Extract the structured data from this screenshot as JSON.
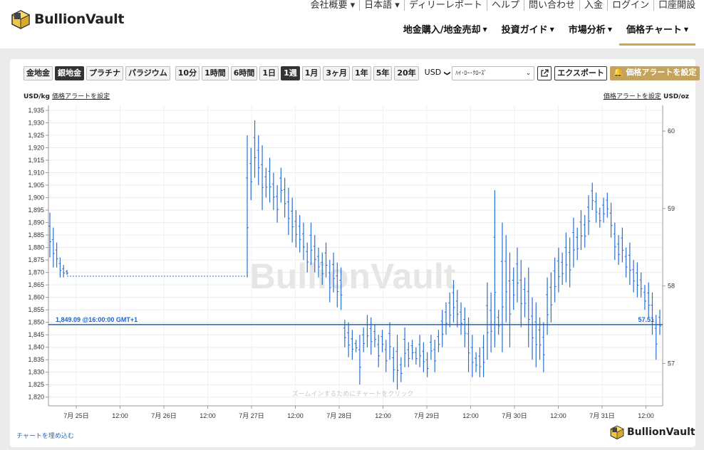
{
  "brand": {
    "name": "BullionVault"
  },
  "top_links": [
    "会社概要 ▾",
    "日本語 ▾",
    "ディリーレポート",
    "ヘルプ",
    "問い合わせ",
    "入金",
    "ログイン",
    "口座開設"
  ],
  "main_nav": [
    {
      "label": "地金購入/地金売却"
    },
    {
      "label": "投資ガイド"
    },
    {
      "label": "市場分析"
    },
    {
      "label": "価格チャート",
      "active": true
    }
  ],
  "toolbar": {
    "metals": [
      "金地金",
      "銀地金",
      "プラチナ",
      "パラジウム"
    ],
    "active_metal": "銀地金",
    "ranges": [
      "10分",
      "1時間",
      "6時間",
      "1日",
      "1週",
      "1月",
      "3ヶ月",
      "1年",
      "5年",
      "20年"
    ],
    "active_range": "1週",
    "currency": "USD",
    "currency_caret": "❯",
    "chart_type": "ﾊｲ･ﾛｰ･ｸﾛｰｽﾞ",
    "export_label": "エクスポート",
    "alert_label": "価格アラートを設定"
  },
  "left_unit": {
    "unit": "USD/kg",
    "link": "価格アラートを設定"
  },
  "right_unit": {
    "unit": "USD/oz",
    "link": "価格アラートを設定"
  },
  "embed_link": "チャートを埋め込む",
  "watermark": "BullionVault",
  "zoom_hint": "ズームインするためにチャートをクリック",
  "chart_data": {
    "type": "ohlc",
    "y_left": {
      "label": "USD/kg",
      "range": [
        1816.5,
        1937
      ],
      "ticks": [
        1820,
        1825,
        1830,
        1835,
        1840,
        1845,
        1850,
        1855,
        1860,
        1865,
        1870,
        1875,
        1880,
        1885,
        1890,
        1895,
        1900,
        1905,
        1910,
        1915,
        1920,
        1925,
        1930,
        1935
      ],
      "tick_labels": [
        "1,820",
        "1,825",
        "1,830",
        "1,835",
        "1,840",
        "1,845",
        "1,850",
        "1,855",
        "1,860",
        "1,865",
        "1,870",
        "1,875",
        "1,880",
        "1,885",
        "1,890",
        "1,895",
        "1,900",
        "1,905",
        "1,910",
        "1,915",
        "1,920",
        "1,925",
        "1,930",
        "1,935"
      ]
    },
    "y_right": {
      "label": "USD/oz",
      "ticks": [
        57,
        58,
        59,
        60
      ],
      "tick_labels": [
        "57",
        "58",
        "59",
        "60"
      ]
    },
    "x_ticks": [
      "7月 25日",
      "12:00",
      "7月 26日",
      "12:00",
      "7月 27日",
      "12:00",
      "7月 28日",
      "12:00",
      "7月 29日",
      "12:00",
      "7月 30日",
      "12:00",
      "7月 31日",
      "12:00"
    ],
    "current_price_label": "1,849.09 @16:00:00 GMT+1",
    "current_price_value": 1849.09,
    "current_oz_label": "57.51",
    "series_color": "#2a6fd6",
    "bars": [
      [
        1894,
        1876
      ],
      [
        1888,
        1872
      ],
      [
        1882,
        1872
      ],
      [
        1876,
        1868
      ],
      [
        1873,
        1868
      ],
      [
        1871,
        1869
      ],
      [
        1925,
        1868
      ],
      [
        1920,
        1899
      ],
      [
        1931,
        1908
      ],
      [
        1925,
        1905
      ],
      [
        1921,
        1895
      ],
      [
        1912,
        1900
      ],
      [
        1916,
        1898
      ],
      [
        1910,
        1895
      ],
      [
        1905,
        1890
      ],
      [
        1912,
        1898
      ],
      [
        1908,
        1892
      ],
      [
        1904,
        1885
      ],
      [
        1900,
        1882
      ],
      [
        1895,
        1880
      ],
      [
        1893,
        1878
      ],
      [
        1890,
        1875
      ],
      [
        1882,
        1870
      ],
      [
        1890,
        1873
      ],
      [
        1885,
        1870
      ],
      [
        1880,
        1868
      ],
      [
        1878,
        1865
      ],
      [
        1882,
        1868
      ],
      [
        1875,
        1858
      ],
      [
        1878,
        1862
      ],
      [
        1874,
        1856
      ],
      [
        1872,
        1855
      ],
      [
        1851,
        1840
      ],
      [
        1850,
        1836
      ],
      [
        1847,
        1835
      ],
      [
        1843,
        1838
      ],
      [
        1845,
        1825
      ],
      [
        1848,
        1838
      ],
      [
        1853,
        1840
      ],
      [
        1852,
        1837
      ],
      [
        1849,
        1840
      ],
      [
        1845,
        1832
      ],
      [
        1847,
        1838
      ],
      [
        1843,
        1830
      ],
      [
        1850,
        1835
      ],
      [
        1840,
        1826
      ],
      [
        1845,
        1823
      ],
      [
        1836,
        1826
      ],
      [
        1848,
        1832
      ],
      [
        1842,
        1832
      ],
      [
        1843,
        1835
      ],
      [
        1840,
        1833
      ],
      [
        1845,
        1832
      ],
      [
        1842,
        1830
      ],
      [
        1838,
        1828
      ],
      [
        1845,
        1835
      ],
      [
        1843,
        1830
      ],
      [
        1847,
        1838
      ],
      [
        1855,
        1840
      ],
      [
        1858,
        1845
      ],
      [
        1862,
        1848
      ],
      [
        1867,
        1850
      ],
      [
        1863,
        1848
      ],
      [
        1858,
        1845
      ],
      [
        1856,
        1840
      ],
      [
        1852,
        1830
      ],
      [
        1845,
        1828
      ],
      [
        1838,
        1830
      ],
      [
        1840,
        1828
      ],
      [
        1845,
        1828
      ],
      [
        1866,
        1835
      ],
      [
        1862,
        1838
      ],
      [
        1903,
        1840
      ],
      [
        1855,
        1845
      ],
      [
        1890,
        1838
      ],
      [
        1885,
        1850
      ],
      [
        1878,
        1840
      ],
      [
        1872,
        1855
      ],
      [
        1880,
        1858
      ],
      [
        1875,
        1848
      ],
      [
        1868,
        1852
      ],
      [
        1872,
        1840
      ],
      [
        1860,
        1835
      ],
      [
        1858,
        1832
      ],
      [
        1852,
        1835
      ],
      [
        1850,
        1830
      ],
      [
        1868,
        1845
      ],
      [
        1870,
        1850
      ],
      [
        1876,
        1858
      ],
      [
        1880,
        1862
      ],
      [
        1878,
        1865
      ],
      [
        1886,
        1866
      ],
      [
        1884,
        1864
      ],
      [
        1892,
        1872
      ],
      [
        1888,
        1875
      ],
      [
        1895,
        1879
      ],
      [
        1893,
        1880
      ],
      [
        1901,
        1885
      ],
      [
        1906,
        1895
      ],
      [
        1902,
        1890
      ],
      [
        1896,
        1888
      ],
      [
        1900,
        1890
      ],
      [
        1902,
        1892
      ],
      [
        1898,
        1884
      ],
      [
        1890,
        1875
      ],
      [
        1885,
        1873
      ],
      [
        1888,
        1874
      ],
      [
        1880,
        1868
      ],
      [
        1882,
        1865
      ],
      [
        1875,
        1862
      ],
      [
        1874,
        1860
      ],
      [
        1870,
        1860
      ],
      [
        1865,
        1855
      ],
      [
        1866,
        1852
      ],
      [
        1862,
        1845
      ],
      [
        1853,
        1835
      ],
      [
        1855,
        1845
      ]
    ]
  }
}
